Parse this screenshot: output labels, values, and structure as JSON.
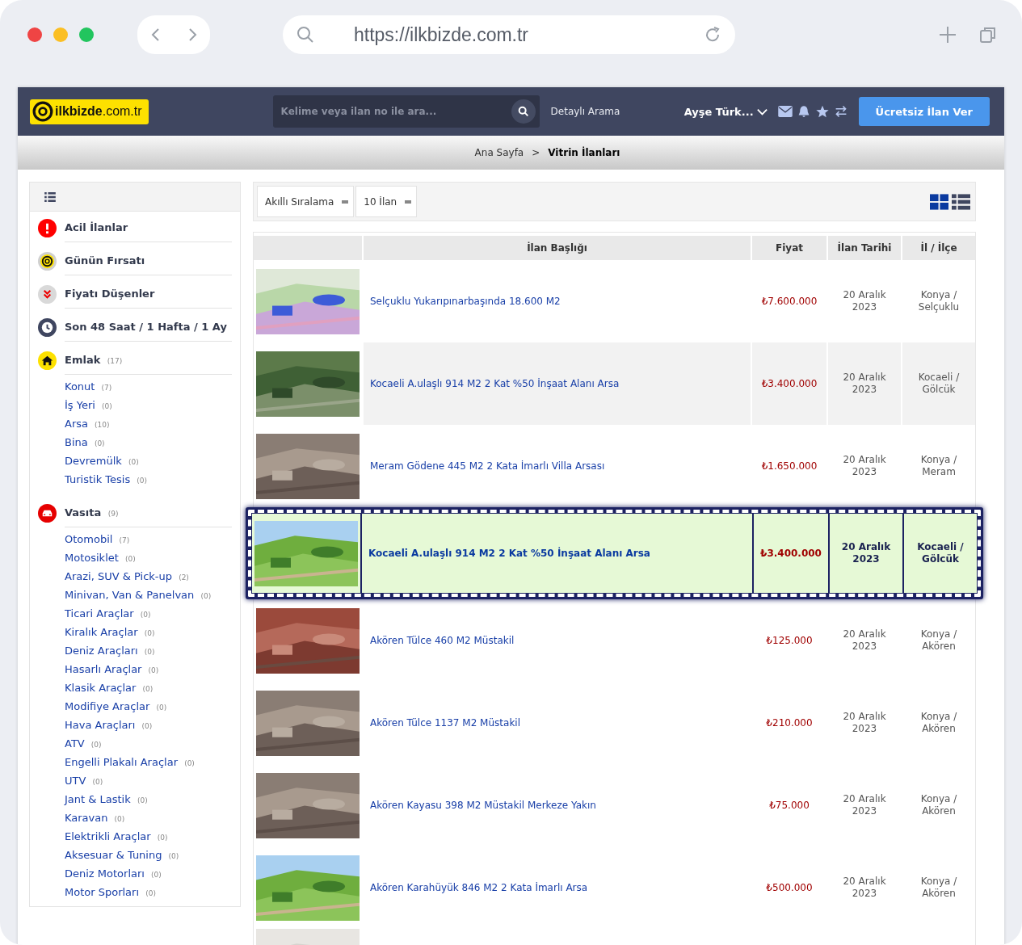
{
  "browser": {
    "url": "https://ilkbizde.com.tr"
  },
  "navbar": {
    "logo": {
      "brand": "ilkbizde",
      "suffix": ".com.tr"
    },
    "search": {
      "placeholder": "Kelime veya ilan no ile ara..."
    },
    "detailed_search": "Detaylı Arama",
    "user": "Ayşe Türk...",
    "post_button": "Ücretsiz İlan Ver"
  },
  "breadcrumb": [
    {
      "label": "Ana Sayfa",
      "current": false
    },
    {
      "label": ">",
      "current": false
    },
    {
      "label": "Vitrin İlanları",
      "current": true
    }
  ],
  "sidebar": {
    "quick_links": [
      {
        "kind": "alert",
        "label": "Acil İlanlar"
      },
      {
        "kind": "deal",
        "label": "Günün Fırsatı"
      },
      {
        "kind": "drop",
        "label": "Fiyatı Düşenler"
      },
      {
        "kind": "clock",
        "label": "Son 48 Saat / 1 Hafta / 1 Ay"
      }
    ],
    "categories": [
      {
        "kind": "home",
        "label": "Emlak",
        "count": "(17)",
        "children": [
          {
            "label": "Konut",
            "count": "(7)"
          },
          {
            "label": "İş Yeri",
            "count": "(0)"
          },
          {
            "label": "Arsa",
            "count": "(10)"
          },
          {
            "label": "Bina",
            "count": "(0)"
          },
          {
            "label": "Devremülk",
            "count": "(0)"
          },
          {
            "label": "Turistik Tesis",
            "count": "(0)"
          }
        ]
      },
      {
        "kind": "car",
        "label": "Vasıta",
        "count": "(9)",
        "children": [
          {
            "label": "Otomobil",
            "count": "(7)"
          },
          {
            "label": "Motosiklet",
            "count": "(0)"
          },
          {
            "label": "Arazi, SUV & Pick-up",
            "count": "(2)"
          },
          {
            "label": "Minivan, Van & Panelvan",
            "count": "(0)"
          },
          {
            "label": "Ticari Araçlar",
            "count": "(0)"
          },
          {
            "label": "Kiralık Araçlar",
            "count": "(0)"
          },
          {
            "label": "Deniz Araçları",
            "count": "(0)"
          },
          {
            "label": "Hasarlı Araçlar",
            "count": "(0)"
          },
          {
            "label": "Klasik Araçlar",
            "count": "(0)"
          },
          {
            "label": "Modifiye Araçlar",
            "count": "(0)"
          },
          {
            "label": "Hava Araçları",
            "count": "(0)"
          },
          {
            "label": "ATV",
            "count": "(0)"
          },
          {
            "label": "Engelli Plakalı Araçlar",
            "count": "(0)"
          },
          {
            "label": "UTV",
            "count": "(0)"
          },
          {
            "label": "Jant & Lastik",
            "count": "(0)"
          },
          {
            "label": "Karavan",
            "count": "(0)"
          },
          {
            "label": "Elektrikli Araçlar",
            "count": "(0)"
          },
          {
            "label": "Aksesuar & Tuning",
            "count": "(0)"
          },
          {
            "label": "Deniz Motorları",
            "count": "(0)"
          },
          {
            "label": "Motor Sporları",
            "count": "(0)"
          }
        ]
      }
    ]
  },
  "toolbar": {
    "sort": "Akıllı Sıralama",
    "per_page": "10 İlan",
    "views": [
      {
        "kind": "grid",
        "selected": true
      },
      {
        "kind": "list",
        "selected": false
      }
    ]
  },
  "table": {
    "columns": [
      "İlan Başlığı",
      "Fiyat",
      "İlan Tarihi",
      "İl / İlçe"
    ],
    "rows": [
      {
        "kind": "normal",
        "title": "Selçuklu Yukarıpınarbaşında 18.600 M2",
        "price": "₺7.600.000",
        "date": "20 Aralık 2023",
        "location": "Konya / Selçuklu"
      },
      {
        "kind": "shaded",
        "title": "Kocaeli A.ulaşlı 914 M2 2 Kat %50 İnşaat Alanı Arsa",
        "price": "₺3.400.000",
        "date": "20 Aralık 2023",
        "location": "Kocaeli / Gölcük"
      },
      {
        "kind": "normal",
        "title": "Meram Gödene 445 M2 2 Kata İmarlı Villa Arsası",
        "price": "₺1.650.000",
        "date": "20 Aralık 2023",
        "location": "Konya / Meram"
      },
      {
        "kind": "featured",
        "title": "Kocaeli A.ulaşlı 914 M2 2 Kat %50 İnşaat Alanı Arsa",
        "price": "₺3.400.000",
        "date": "20 Aralık 2023",
        "location": "Kocaeli / Gölcük"
      },
      {
        "kind": "normal",
        "title": "Akören Tülce 460 M2 Müstakil",
        "price": "₺125.000",
        "date": "20 Aralık 2023",
        "location": "Konya / Akören"
      },
      {
        "kind": "normal",
        "title": "Akören Tülce 1137 M2 Müstakil",
        "price": "₺210.000",
        "date": "20 Aralık 2023",
        "location": "Konya / Akören"
      },
      {
        "kind": "normal",
        "title": "Akören Kayasu 398 M2 Müstakil Merkeze Yakın",
        "price": "₺75.000",
        "date": "20 Aralık 2023",
        "location": "Konya / Akören"
      },
      {
        "kind": "normal",
        "title": "Akören Karahüyük 846 M2 2 Kata İmarlı Arsa",
        "price": "₺500.000",
        "date": "20 Aralık 2023",
        "location": "Konya / Akören"
      },
      {
        "kind": "partial"
      }
    ]
  }
}
